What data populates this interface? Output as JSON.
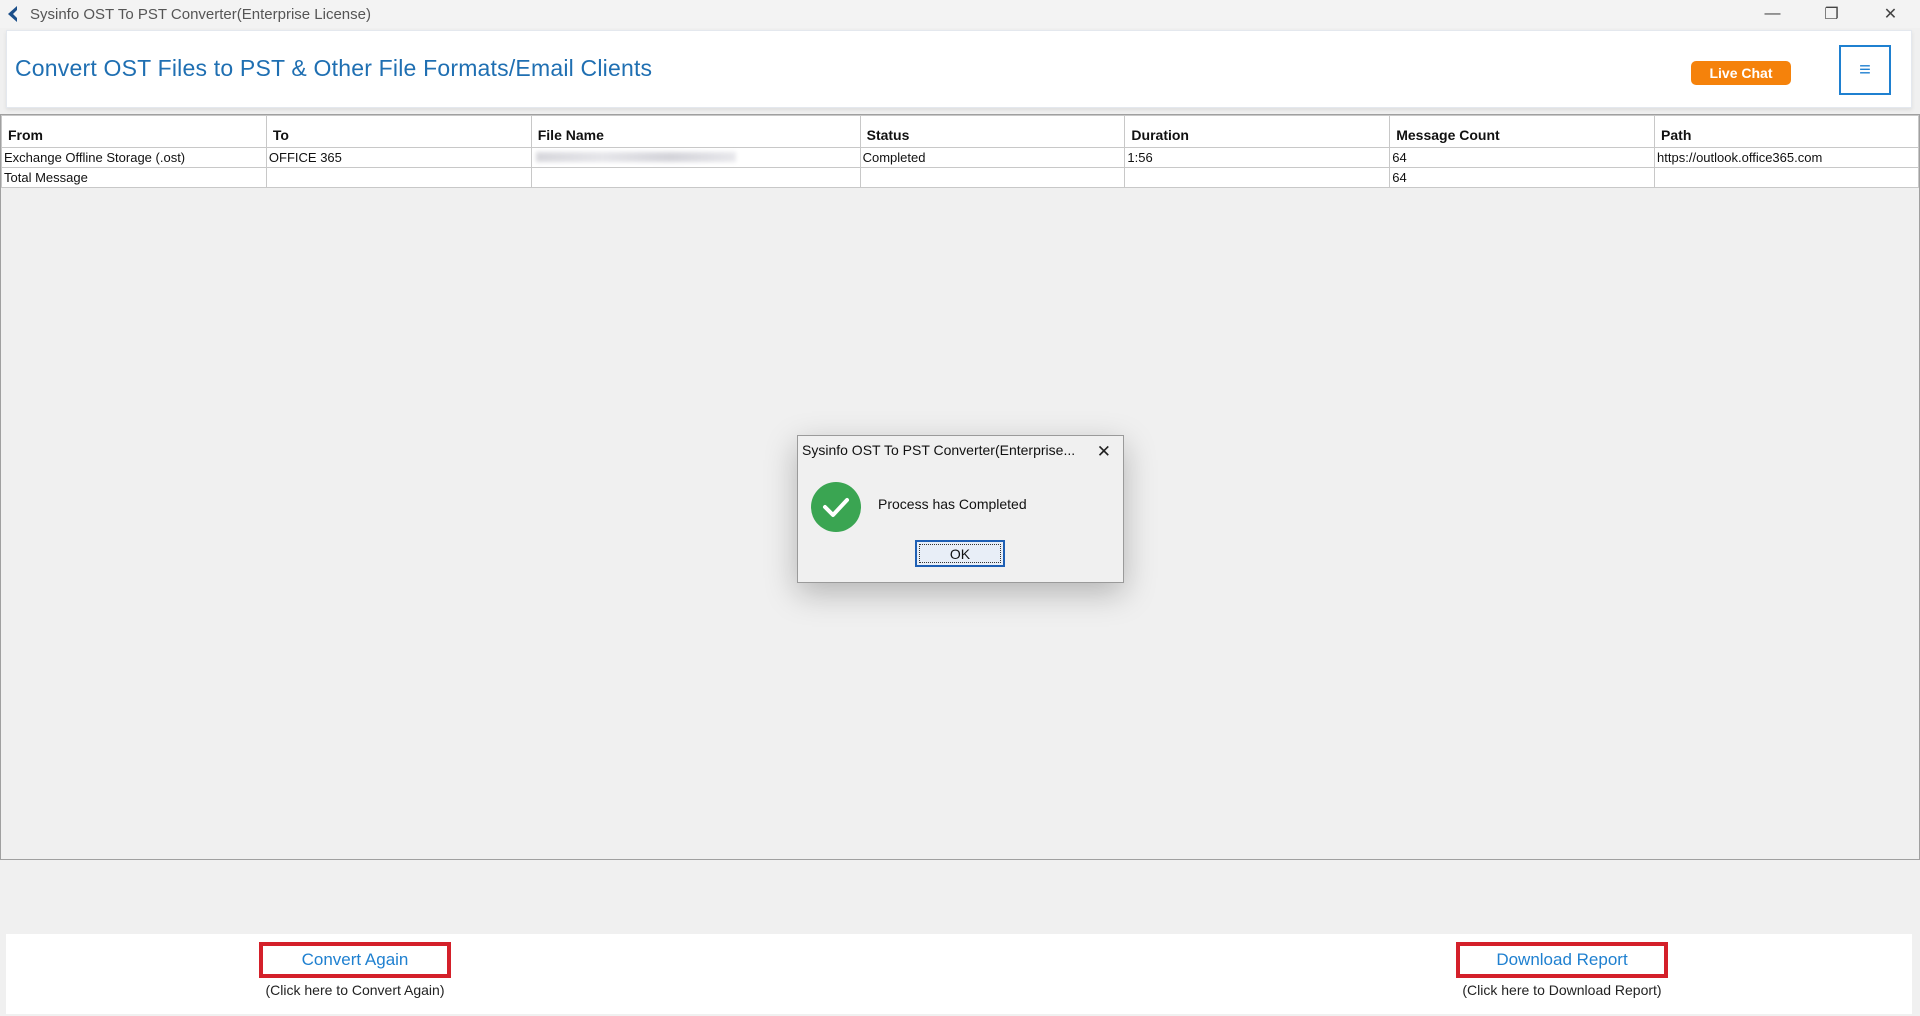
{
  "window": {
    "title": "Sysinfo OST To PST Converter(Enterprise License)",
    "controls": {
      "minimize": "—",
      "restore": "❐",
      "close": "✕"
    }
  },
  "header": {
    "title": "Convert OST Files to PST & Other File Formats/Email Clients",
    "live_chat": "Live Chat",
    "menu_icon": "≡",
    "accent": "#1f6fb2",
    "live_chat_color": "#f5820b"
  },
  "table": {
    "columns": [
      "From",
      "To",
      "File Name",
      "Status",
      "Duration",
      "Message Count",
      "Path"
    ],
    "rows": [
      {
        "from": "Exchange Offline Storage (.ost)",
        "to": "OFFICE 365",
        "file_name": "",
        "status": "Completed",
        "duration": "1:56",
        "message_count": "64",
        "path": "https://outlook.office365.com"
      },
      {
        "from": "Total Message",
        "to": "",
        "file_name": "",
        "status": "",
        "duration": "",
        "message_count": "64",
        "path": ""
      }
    ]
  },
  "dialog": {
    "title": "Sysinfo OST To PST Converter(Enterprise...",
    "close": "✕",
    "message": "Process has Completed",
    "ok": "OK",
    "icon": "success-check-icon"
  },
  "footer": {
    "convert_again": "Convert Again",
    "convert_again_hint": "(Click here to Convert Again)",
    "download_report": "Download Report",
    "download_report_hint": "(Click here to Download Report)"
  }
}
